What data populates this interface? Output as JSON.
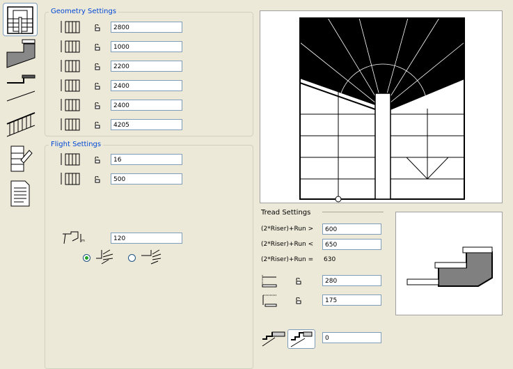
{
  "toolbar": {
    "items": [
      {
        "name": "plan-geometry",
        "selected": true
      },
      {
        "name": "structure"
      },
      {
        "name": "tread"
      },
      {
        "name": "railing"
      },
      {
        "name": "edit-plan"
      },
      {
        "name": "listing"
      }
    ]
  },
  "geometry": {
    "title": "Geometry Settings",
    "rows": [
      {
        "icon": "total-height-icon",
        "value": "2800"
      },
      {
        "icon": "flight-width-icon",
        "value": "1000"
      },
      {
        "icon": "landing-width-icon",
        "value": "2200"
      },
      {
        "icon": "left-length-icon",
        "value": "2400"
      },
      {
        "icon": "right-length-icon",
        "value": "2400"
      },
      {
        "icon": "walkline-length-icon",
        "value": "4205"
      }
    ]
  },
  "flight": {
    "title": "Flight Settings",
    "rows": [
      {
        "icon": "riser-count-icon",
        "value": "16"
      },
      {
        "icon": "walkline-offset-icon",
        "value": "500"
      }
    ],
    "min_value": "120",
    "radio_selected": 0
  },
  "tread": {
    "title": "Tread Settings",
    "rule_gt_label": "(2*Riser)+Run >",
    "rule_gt_value": "600",
    "rule_lt_label": "(2*Riser)+Run <",
    "rule_lt_value": "650",
    "rule_eq_label": "(2*Riser)+Run =",
    "rule_eq_value": "630",
    "run_value": "280",
    "riser_value": "175",
    "nosing_value": "0"
  }
}
